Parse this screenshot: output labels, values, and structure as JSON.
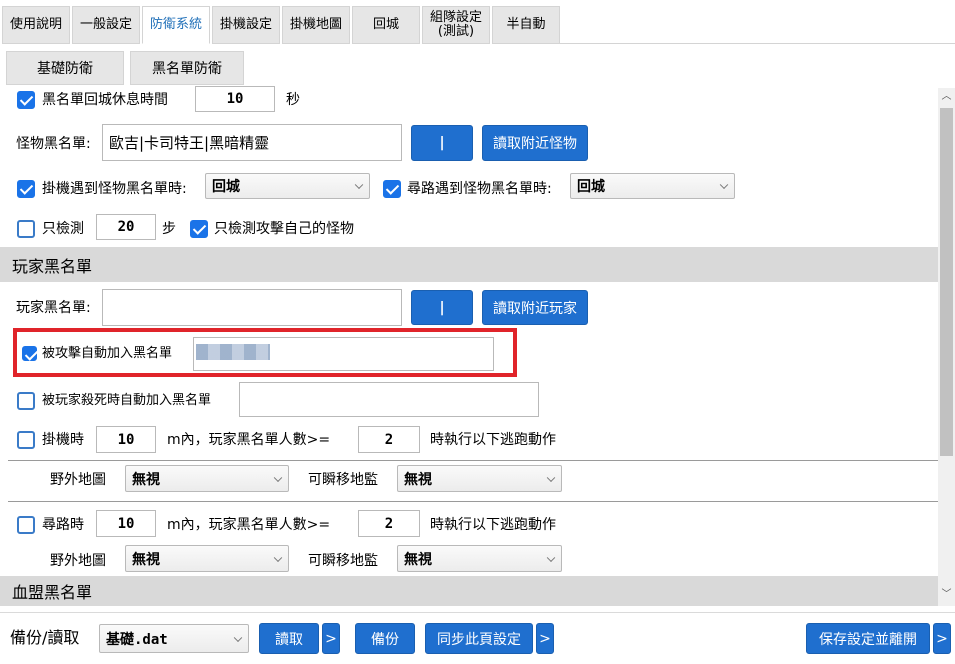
{
  "tabs": [
    {
      "label": "使用說明"
    },
    {
      "label": "一般設定"
    },
    {
      "label": "防衛系統",
      "active": true
    },
    {
      "label": "掛機設定"
    },
    {
      "label": "掛機地圖"
    },
    {
      "label": "回城"
    },
    {
      "label": "組隊設定\n(測試)"
    },
    {
      "label": "半自動"
    }
  ],
  "subtabs": [
    {
      "label": "基礎防衛"
    },
    {
      "label": "黑名單防衛"
    }
  ],
  "monster": {
    "rest_label": "黑名單回城休息時間",
    "rest_value": "10",
    "rest_unit": "秒",
    "list_label": "怪物黑名單:",
    "list_value": "歐吉|卡司特王|黑暗精靈",
    "separator_btn": "|",
    "read_btn": "讀取附近怪物",
    "idle_label": "掛機遇到怪物黑名單時:",
    "idle_select": "回城",
    "route_label": "尋路遇到怪物黑名單時:",
    "route_select": "回城",
    "only_detect_label": "只檢測",
    "only_detect_value": "20",
    "only_detect_unit": "步",
    "only_attack_label": "只檢測攻擊自己的怪物"
  },
  "player": {
    "section_title": "玩家黑名單",
    "list_label": "玩家黑名單:",
    "list_value": "",
    "separator_btn": "|",
    "read_btn": "讀取附近玩家",
    "attacked_label": "被攻擊自動加入黑名單",
    "killed_label": "被玩家殺死時自動加入黑名單",
    "idle_label": "掛機時",
    "idle_distance": "10",
    "idle_mid": "m內，玩家黑名單人數>=",
    "idle_count": "2",
    "idle_tail": "時執行以下逃跑動作",
    "idle_field_label": "野外地圖",
    "idle_field_select": "無視",
    "idle_tp_label": "可瞬移地監",
    "idle_tp_select": "無視",
    "route_label": "尋路時",
    "route_distance": "10",
    "route_mid": "m內，玩家黑名單人數>=",
    "route_count": "2",
    "route_tail": "時執行以下逃跑動作",
    "route_field_label": "野外地圖",
    "route_field_select": "無視",
    "route_tp_label": "可瞬移地監",
    "route_tp_select": "無視"
  },
  "clan": {
    "section_title": "血盟黑名單"
  },
  "footer": {
    "backup_label": "備份/讀取",
    "file_select": "基礎.dat",
    "read_btn": "讀取",
    "more1": ">",
    "backup_btn": "備份",
    "sync_btn": "同步此頁設定",
    "more2": ">",
    "save_btn": "保存設定並離開",
    "more3": ">"
  },
  "colors": {
    "accent": "#1f6fcf",
    "highlight_box": "#e0242a",
    "active_tab_text": "#1f6fb8"
  }
}
